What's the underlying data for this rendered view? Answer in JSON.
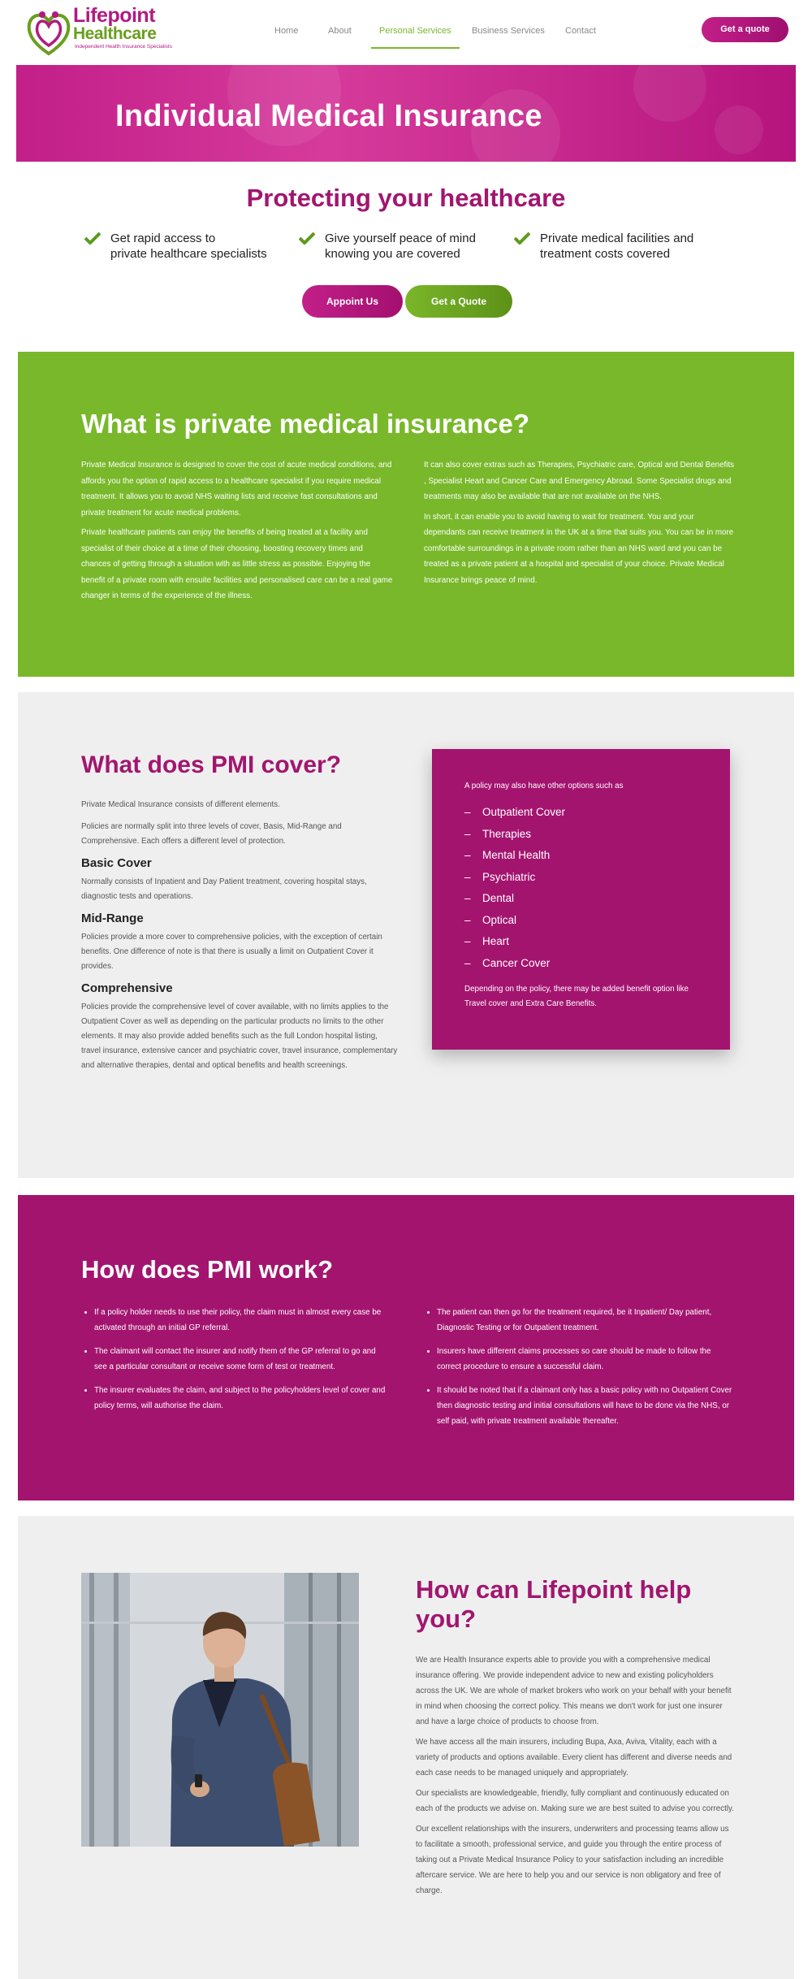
{
  "header": {
    "logo": {
      "line1": "Lifepoint",
      "line2": "Healthcare",
      "tagline": "Independent Health Insurance Specialists"
    },
    "nav": [
      {
        "label": "Home"
      },
      {
        "label": "About"
      },
      {
        "label": "Personal Services",
        "active": true
      },
      {
        "label": "Business Services"
      },
      {
        "label": "Contact"
      }
    ],
    "cta": "Get a quote"
  },
  "hero": {
    "title": "Individual Medical Insurance"
  },
  "protect": {
    "title": "Protecting your healthcare",
    "benefits": [
      {
        "line1": "Get rapid access to",
        "line2": "private healthcare specialists"
      },
      {
        "line1": "Give yourself peace of mind",
        "line2": "knowing you are covered"
      },
      {
        "line1": "Private medical facilities and",
        "line2": "treatment costs covered"
      }
    ],
    "appoint_btn": "Appoint Us",
    "quote_btn": "Get a Quote"
  },
  "what": {
    "title": "What is private medical insurance?",
    "left": [
      "Private Medical Insurance is designed to cover the cost of acute medical conditions, and affords you the option of rapid access to a healthcare specialist if you require medical treatment. It allows you to avoid NHS waiting lists and receive fast consultations and private treatment for acute medical problems.",
      "Private healthcare patients can enjoy the benefits of being treated at a facility and specialist of their choice at a time of their choosing, boosting recovery times and chances of getting through a situation with as little stress as possible. Enjoying the benefit of a private room with ensuite facilities and personalised care can be a real game changer in terms of the experience of the illness."
    ],
    "right": [
      "It can also cover extras such as Therapies, Psychiatric care, Optical and Dental Benefits , Specialist Heart and Cancer Care and Emergency Abroad. Some Specialist drugs and treatments may also be available that are not available on the NHS.",
      "In short, it can enable you to avoid having to wait for treatment. You and your dependants can receive treatment in the UK at a time that suits you. You can be in more comfortable surroundings in a private room rather than an NHS ward and you can be treated as a private patient at a hospital and specialist of your choice. Private Medical Insurance brings peace of mind."
    ]
  },
  "cover": {
    "title": "What does PMI cover?",
    "p1": "Private Medical Insurance consists of different elements.",
    "p2": "Policies are normally split into three levels of cover, Basis, Mid-Range and Comprehensive. Each offers a different level of protection.",
    "basic_title": "Basic Cover",
    "basic_text": "Normally consists of Inpatient and Day Patient treatment, covering hospital stays, diagnostic tests and operations.",
    "mid_title": "Mid-Range",
    "mid_text": "Policies provide a more cover to comprehensive policies, with the exception of certain benefits. One difference of note is that there is usually a limit on Outpatient Cover it provides.",
    "comp_title": "Comprehensive",
    "comp_text": "Policies provide the comprehensive level of cover available, with no limits applies to the Outpatient Cover as well as depending on the particular products no limits to the other elements. It may also provide added benefits such as the full London hospital listing, travel insurance, extensive cancer and psychiatric cover, travel insurance, complementary and alternative therapies, dental and optical benefits and health screenings.",
    "box": {
      "intro": "A policy may also have other options such as",
      "dash": "–",
      "items": [
        "Outpatient Cover",
        "Therapies",
        "Mental Health",
        "Psychiatric",
        "Dental",
        "Optical",
        "Heart",
        "Cancer Cover"
      ],
      "outro": "Depending on the policy, there may be added benefit option like Travel cover and Extra Care Benefits."
    }
  },
  "work": {
    "title": "How does PMI work?",
    "left": [
      "If a policy holder needs to use their policy, the claim must in almost every case be activated through an initial GP referral.",
      "The claimant will contact the insurer and notify them of the GP referral to go and see a particular consultant or receive some form of test or treatment.",
      "The insurer evaluates the claim, and subject to the policyholders level of cover and policy terms, will authorise the claim."
    ],
    "right": [
      "The patient can then go for the treatment required, be it Inpatient/ Day patient, Diagnostic Testing or for Outpatient treatment.",
      "Insurers have different claims processes so care should be made to follow the correct procedure to ensure a successful claim.",
      "It should be noted that if a claimant only has a basic policy with no Outpatient Cover then diagnostic testing and initial consultations will have to be done via the NHS, or self paid, with private treatment available thereafter."
    ]
  },
  "help": {
    "title": "How can Lifepoint help you?",
    "paras": [
      "We are Health Insurance experts able to provide you with a comprehensive medical insurance offering. We provide independent advice to new and existing policyholders across the UK. We are whole of market brokers who work on your behalf with your benefit in mind when choosing the correct policy. This means we don't work for just one insurer and have a large choice of products to choose from.",
      "We have access all the main insurers, including Bupa, Axa, Aviva, Vitality, each with a variety of products and options available. Every client has different and diverse needs and each case needs to be managed uniquely and appropriately.",
      "Our specialists are knowledgeable, friendly, fully compliant and continuously educated on each of the products we advise on. Making sure we are best suited to advise you correctly.",
      "Our excellent relationships with the insurers, underwriters and processing teams allow us to facilitate a smooth, professional service, and guide you through the entire process of taking out a Private Medical Insurance Policy to your satisfaction including an incredible aftercare service. We are here to help you and our service is non obligatory and free of charge."
    ]
  },
  "colors": {
    "brand_pink": "#a3146f",
    "brand_green": "#78b82a"
  }
}
